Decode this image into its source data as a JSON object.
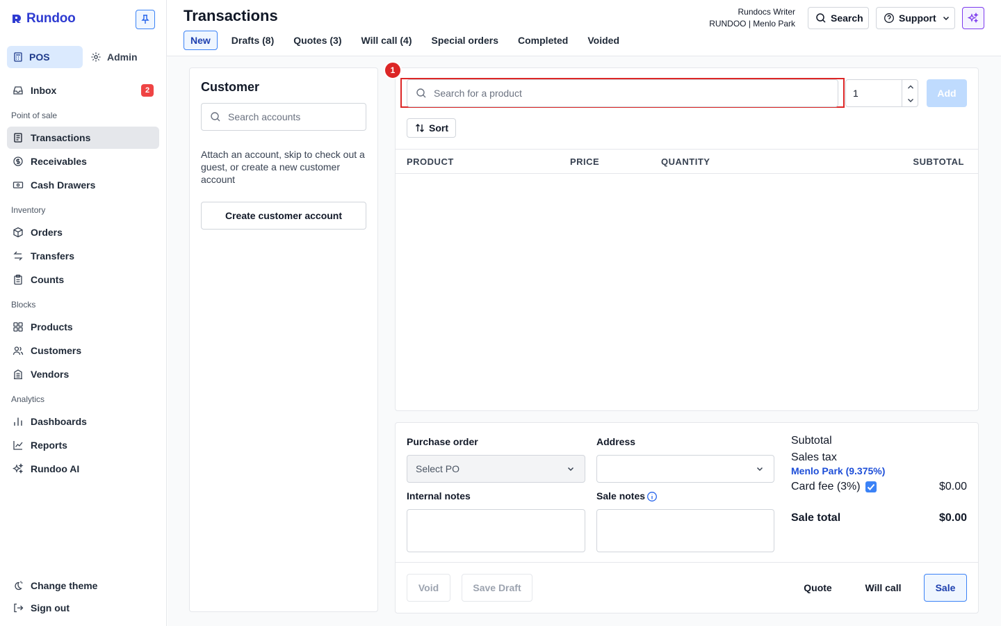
{
  "app": {
    "name": "Rundoo"
  },
  "sidebar": {
    "modes": {
      "pos": "POS",
      "admin": "Admin"
    },
    "inbox": {
      "label": "Inbox",
      "count": "2"
    },
    "sections": {
      "point_of_sale": "Point of sale",
      "inventory": "Inventory",
      "blocks": "Blocks",
      "analytics": "Analytics"
    },
    "items": {
      "transactions": "Transactions",
      "receivables": "Receivables",
      "cash_drawers": "Cash Drawers",
      "orders": "Orders",
      "transfers": "Transfers",
      "counts": "Counts",
      "products": "Products",
      "customers": "Customers",
      "vendors": "Vendors",
      "dashboards": "Dashboards",
      "reports": "Reports",
      "rundoo_ai": "Rundoo AI"
    },
    "footer": {
      "change_theme": "Change theme",
      "sign_out": "Sign out"
    }
  },
  "header": {
    "title": "Transactions",
    "tabs": [
      "New",
      "Drafts (8)",
      "Quotes (3)",
      "Will call (4)",
      "Special orders",
      "Completed",
      "Voided"
    ],
    "active_tab": "New",
    "user_name": "Rundocs Writer",
    "store": "RUNDOO | Menlo Park",
    "search_label": "Search",
    "support_label": "Support"
  },
  "customer": {
    "title": "Customer",
    "search_placeholder": "Search accounts",
    "description": "Attach an account, skip to check out a guest, or create a new customer account",
    "create_button": "Create customer account"
  },
  "product": {
    "marker": "1",
    "search_placeholder": "Search for a product",
    "quantity": "1",
    "add_button": "Add",
    "sort_button": "Sort",
    "columns": [
      "PRODUCT",
      "PRICE",
      "QUANTITY",
      "SUBTOTAL"
    ]
  },
  "order": {
    "purchase_order_label": "Purchase order",
    "purchase_order_placeholder": "Select PO",
    "address_label": "Address",
    "internal_notes_label": "Internal notes",
    "sale_notes_label": "Sale notes"
  },
  "summary": {
    "subtotal_label": "Subtotal",
    "sales_tax_label": "Sales tax",
    "tax_location": "Menlo Park (9.375%)",
    "card_fee_label": "Card fee (3%)",
    "card_fee_checked": true,
    "card_fee_value": "$0.00",
    "sale_total_label": "Sale total",
    "sale_total_value": "$0.00"
  },
  "footer_actions": {
    "void": "Void",
    "save_draft": "Save Draft",
    "quote": "Quote",
    "will_call": "Will call",
    "sale": "Sale"
  },
  "colors": {
    "brand": "#2e3bd1",
    "accent": "#3b82f6",
    "alert": "#dc2626",
    "ai": "#7c3aed"
  }
}
